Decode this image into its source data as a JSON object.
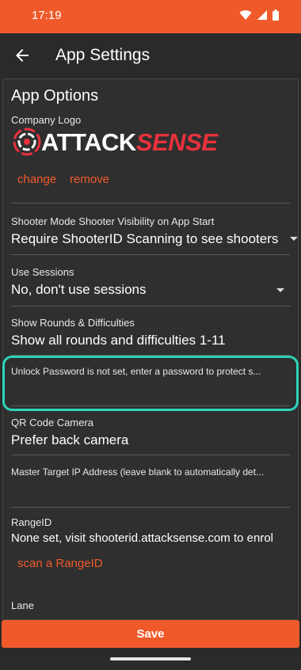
{
  "status": {
    "time": "17:19"
  },
  "header": {
    "title": "App Settings"
  },
  "section": {
    "title": "App Options"
  },
  "logo": {
    "label": "Company Logo",
    "brand_attack": "ATTACK",
    "brand_sense": "SENSE",
    "change": "change",
    "remove": "remove"
  },
  "shooter_mode": {
    "label": "Shooter Mode Shooter Visibility on App Start",
    "value": "Require ShooterID Scanning to see shooters"
  },
  "sessions": {
    "label": "Use Sessions",
    "value": "No, don't use sessions"
  },
  "rounds": {
    "label": "Show Rounds & Difficulties",
    "value": "Show all rounds and difficulties 1-11"
  },
  "unlock": {
    "label": "Unlock Password is not set, enter a password to protect s..."
  },
  "camera": {
    "label": "QR Code Camera",
    "value": "Prefer back camera"
  },
  "master_ip": {
    "label": "Master Target IP Address (leave blank to automatically det..."
  },
  "range": {
    "label": "RangeID",
    "value": "None set, visit shooterid.attacksense.com to enrol",
    "scan": "scan a RangeID"
  },
  "lane": {
    "label": "Lane"
  },
  "footer": {
    "save": "Save"
  },
  "colors": {
    "accent": "#f05a2b",
    "highlight": "#2ed3b9",
    "brand_red": "#e8323c"
  },
  "icons": [
    "wifi-icon",
    "signal-icon",
    "battery-icon",
    "back-arrow-icon",
    "dropdown-caret-icon",
    "target-logo-icon"
  ]
}
